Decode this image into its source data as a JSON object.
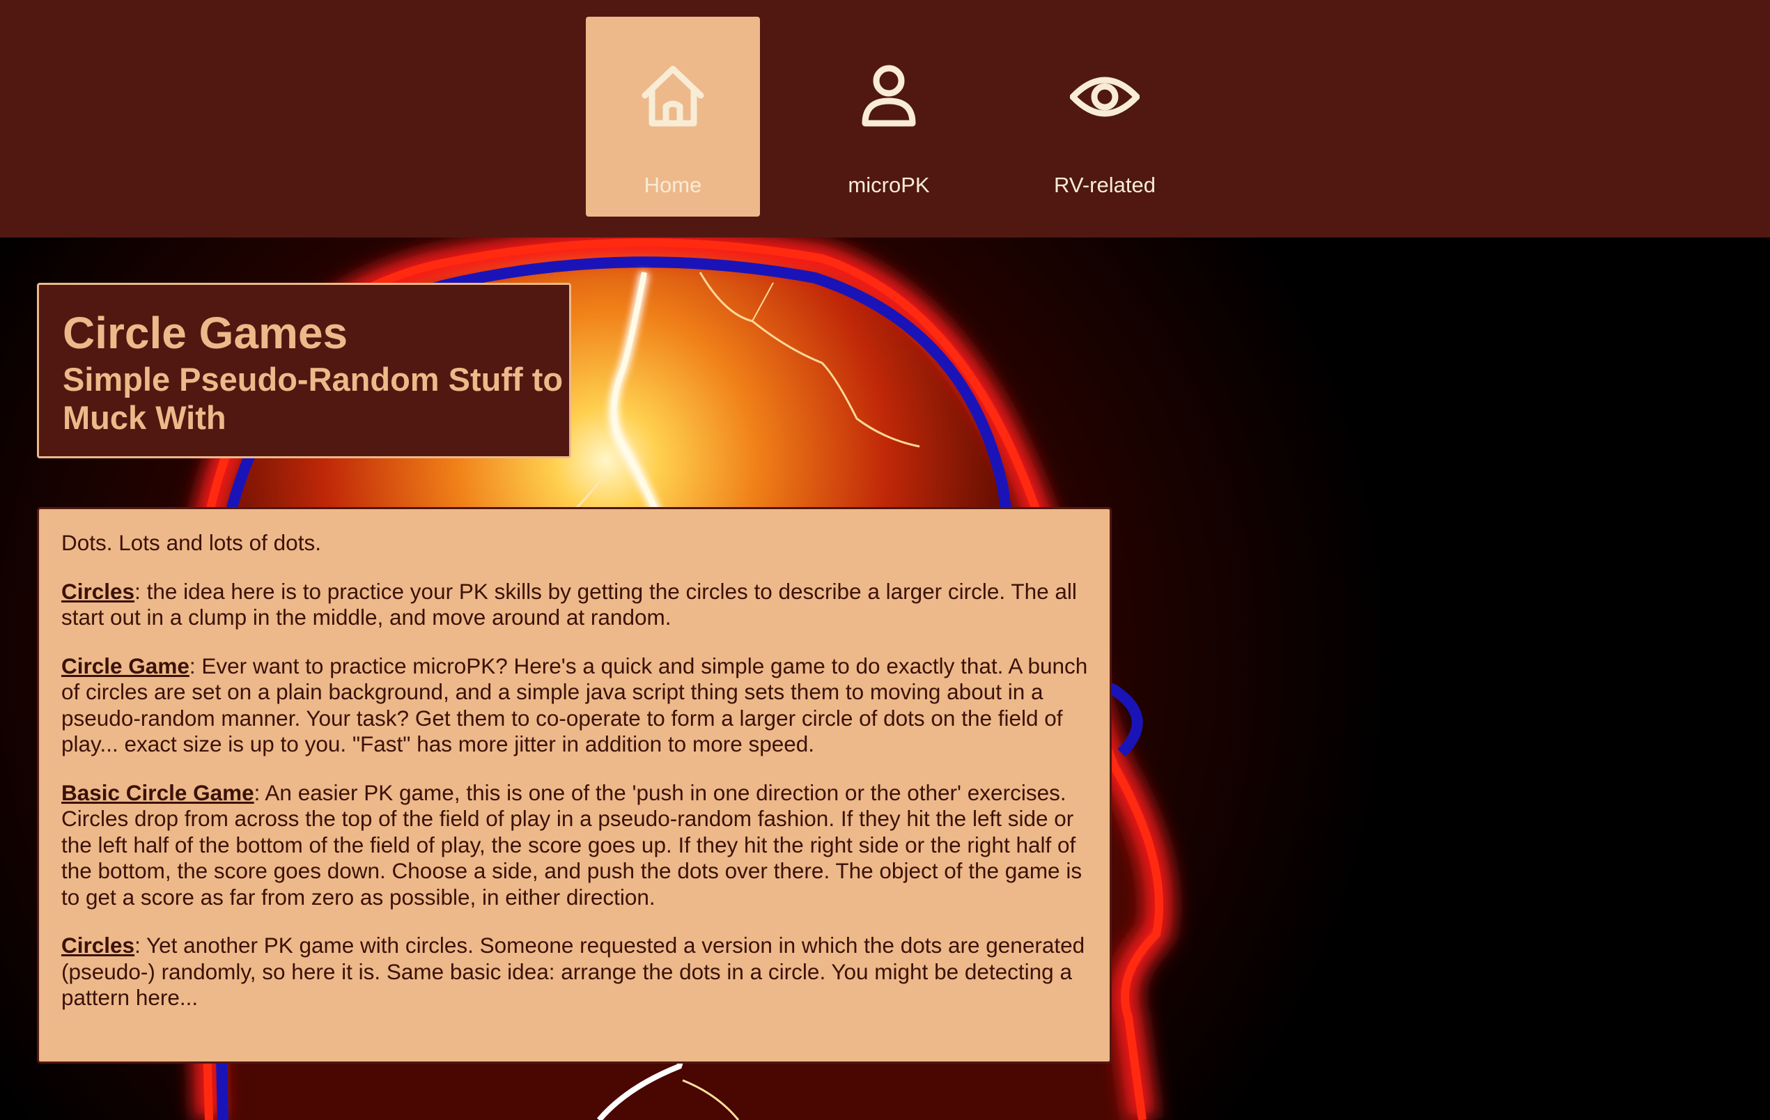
{
  "nav": {
    "items": [
      {
        "label": "Home",
        "icon": "home-icon",
        "active": true
      },
      {
        "label": "microPK",
        "icon": "user-icon",
        "active": false
      },
      {
        "label": "RV-related",
        "icon": "eye-icon",
        "active": false
      }
    ]
  },
  "header": {
    "title": "Circle Games",
    "subtitle": "Simple Pseudo-Random Stuff to Muck With"
  },
  "content": {
    "intro": "Dots. Lots and lots of dots.",
    "entries": [
      {
        "link": "Circles",
        "text": ": the idea here is to practice your PK skills by getting the circles to describe a larger circle. The all start out in a clump in the middle, and move around at random."
      },
      {
        "link": "Circle Game",
        "text": ": Ever want to practice microPK? Here's a quick and simple game to do exactly that. A bunch of circles are set on a plain background, and a simple java script thing sets them to moving about in a pseudo-random manner. Your task? Get them to co-operate to form a larger circle of dots on the field of play... exact size is up to you. \"Fast\" has more jitter in addition to more speed."
      },
      {
        "link": "Basic Circle Game",
        "text": ": An easier PK game, this is one of the 'push in one direction or the other' exercises. Circles drop from across the top of the field of play in a pseudo-random fashion. If they hit the left side or the left half of the bottom of the field of play, the score goes up. If they hit the right side or the right half of the bottom, the score goes down. Choose a side, and push the dots over there. The object of the game is to get a score as far from zero as possible, in either direction."
      },
      {
        "link": "Circles",
        "text": ": Yet another PK game with circles. Someone requested a version in which the dots are generated (pseudo-) randomly, so here it is. Same basic idea: arrange the dots in a circle. You might be detecting a pattern here..."
      }
    ]
  },
  "colors": {
    "nav_bg": "#501811",
    "nav_active_bg": "#edb98a",
    "nav_text": "#f8ecd6",
    "title_text": "#edb98a",
    "content_bg": "#edb98a",
    "content_text": "#3b1109"
  }
}
